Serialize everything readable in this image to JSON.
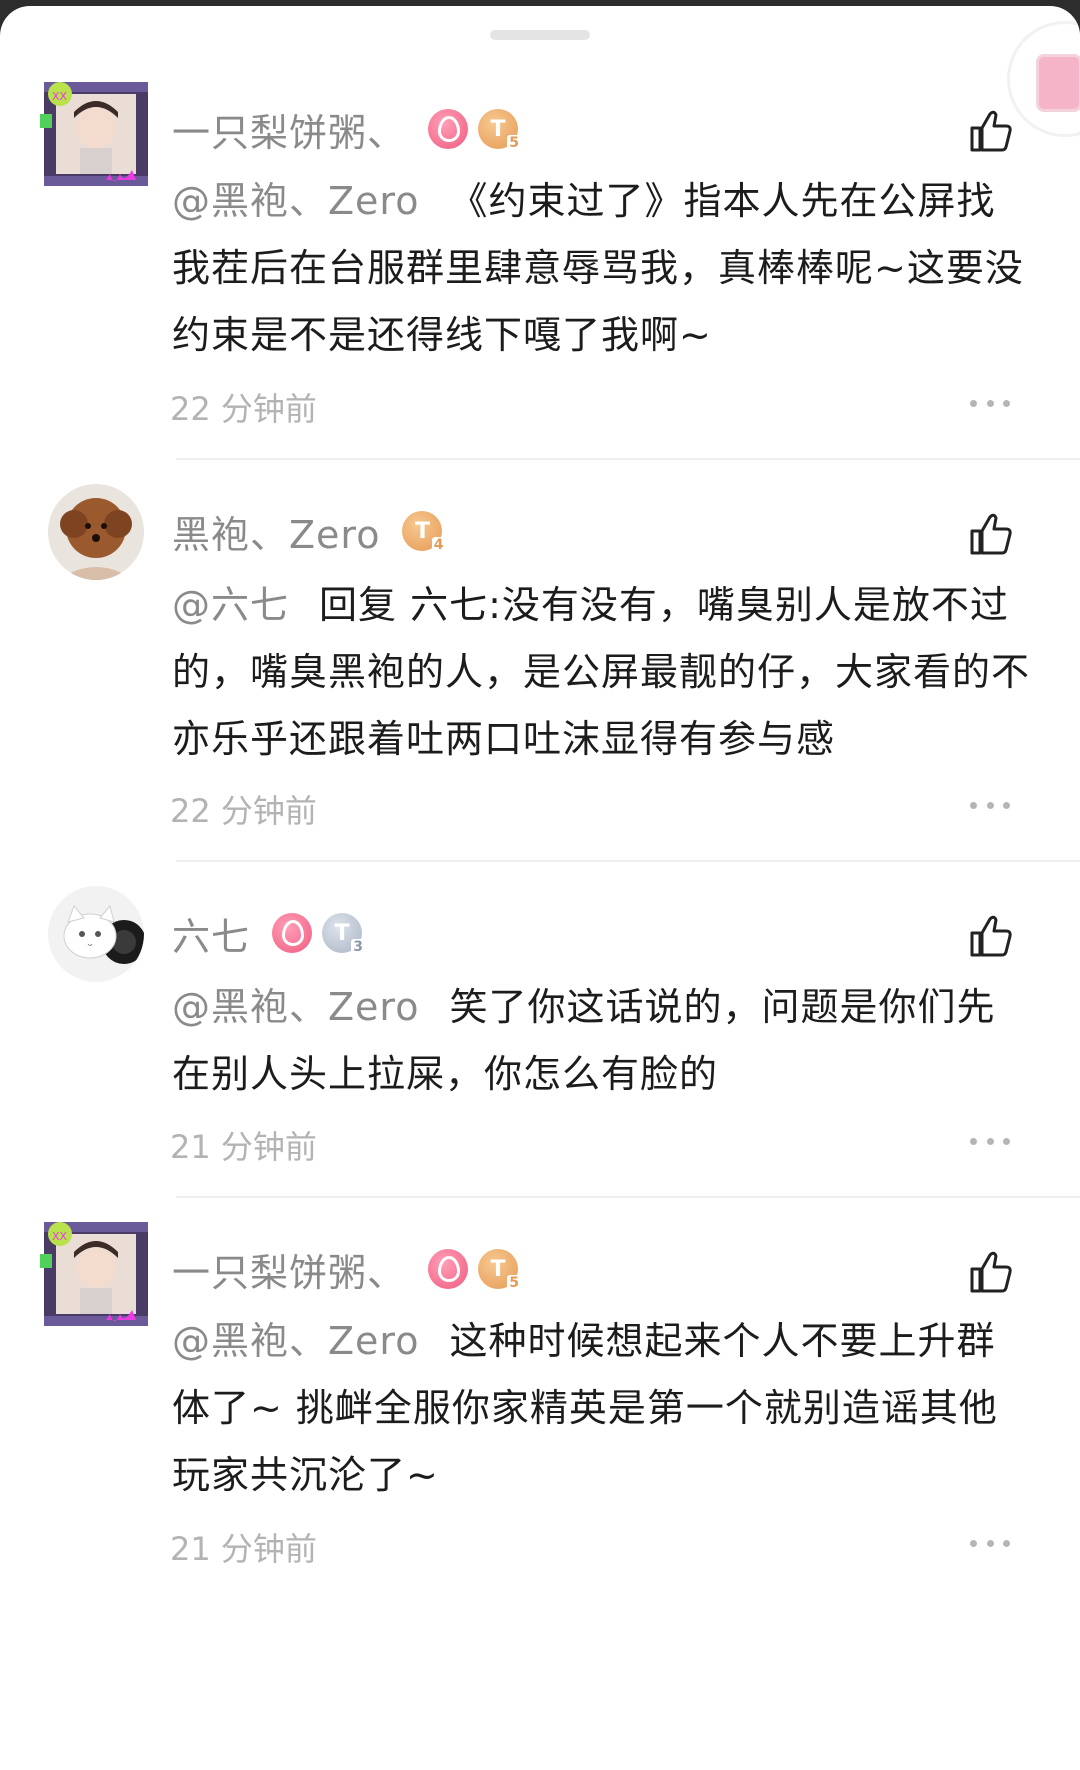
{
  "comments": [
    {
      "username": "一只梨饼粥、",
      "badges": [
        "fire",
        "T5"
      ],
      "mention": "@黑袍、Zero",
      "text": "《约束过了》指本人先在公屏找我茬后在台服群里肆意辱骂我，真棒棒呢~这要没约束是不是还得线下嘎了我啊~",
      "time": "22 分钟前"
    },
    {
      "username": "黑袍、Zero",
      "badges": [
        "T4"
      ],
      "mention": "@六七",
      "text": "回复 六七:没有没有，嘴臭别人是放不过的，嘴臭黑袍的人，是公屏最靓的仔，大家看的不亦乐乎还跟着吐两口吐沫显得有参与感",
      "time": "22 分钟前"
    },
    {
      "username": "六七",
      "badges": [
        "fire",
        "T3"
      ],
      "mention": "@黑袍、Zero",
      "text": "笑了你这话说的，问题是你们先在别人头上拉屎，你怎么有脸的",
      "time": "21 分钟前"
    },
    {
      "username": "一只梨饼粥、",
      "badges": [
        "fire",
        "T5"
      ],
      "mention": "@黑袍、Zero",
      "text": "这种时候想起来个人不要上升群体了~ 挑衅全服你家精英是第一个就别造谣其他玩家共沉沦了~",
      "time": "21 分钟前"
    }
  ],
  "badge_labels": {
    "T5": {
      "letter": "T",
      "level": "5"
    },
    "T4": {
      "letter": "T",
      "level": "4"
    },
    "T3": {
      "letter": "T",
      "level": "3"
    }
  },
  "colors": {
    "text": "#1c1c1c",
    "muted": "#8a8a8a",
    "time": "#b3b3b3",
    "fire_badge": "#f05a7e",
    "gold_badge": "#e59a55",
    "silver_badge": "#a9b4c4"
  }
}
